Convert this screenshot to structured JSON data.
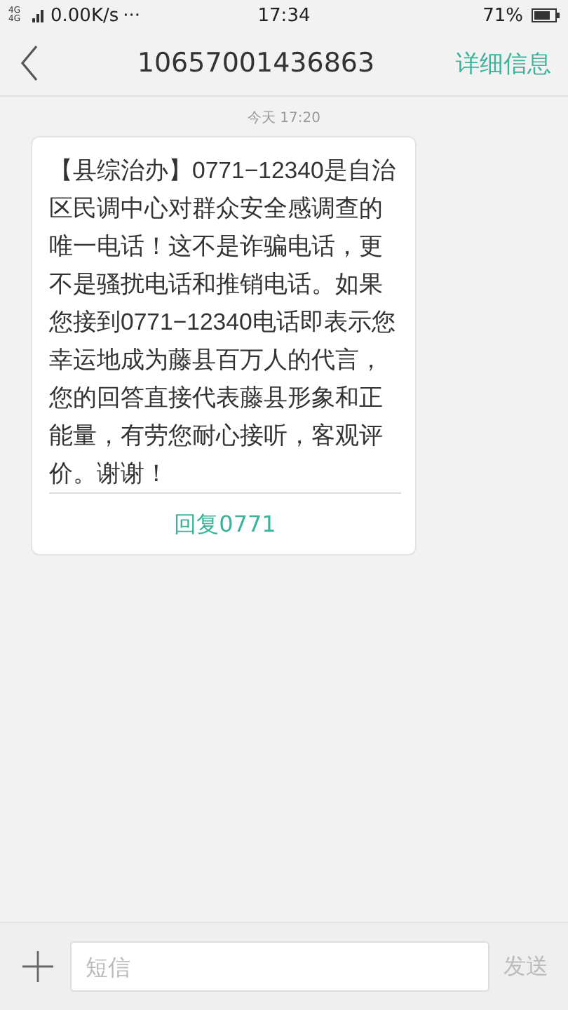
{
  "status_bar": {
    "network": "4G 4G",
    "speed": "0.00K/s",
    "more": "···",
    "time": "17:34",
    "battery_text": "71%"
  },
  "header": {
    "title": "10657001436863",
    "details": "详细信息"
  },
  "messages": [
    {
      "timestamp": "今天 17:20",
      "body": "【县综治办】0771−12340是自治区民调中心对群众安全感调查的唯一电话！这不是诈骗电话，更不是骚扰电话和推销电话。如果您接到0771−12340电话即表示您幸运地成为藤县百万人的代言，您的回答直接代表藤县形象和正能量，有劳您耐心接听，客观评价。谢谢！",
      "reply": "回复0771"
    }
  ],
  "composer": {
    "placeholder": "短信",
    "send": "发送",
    "send_disabled": true
  }
}
